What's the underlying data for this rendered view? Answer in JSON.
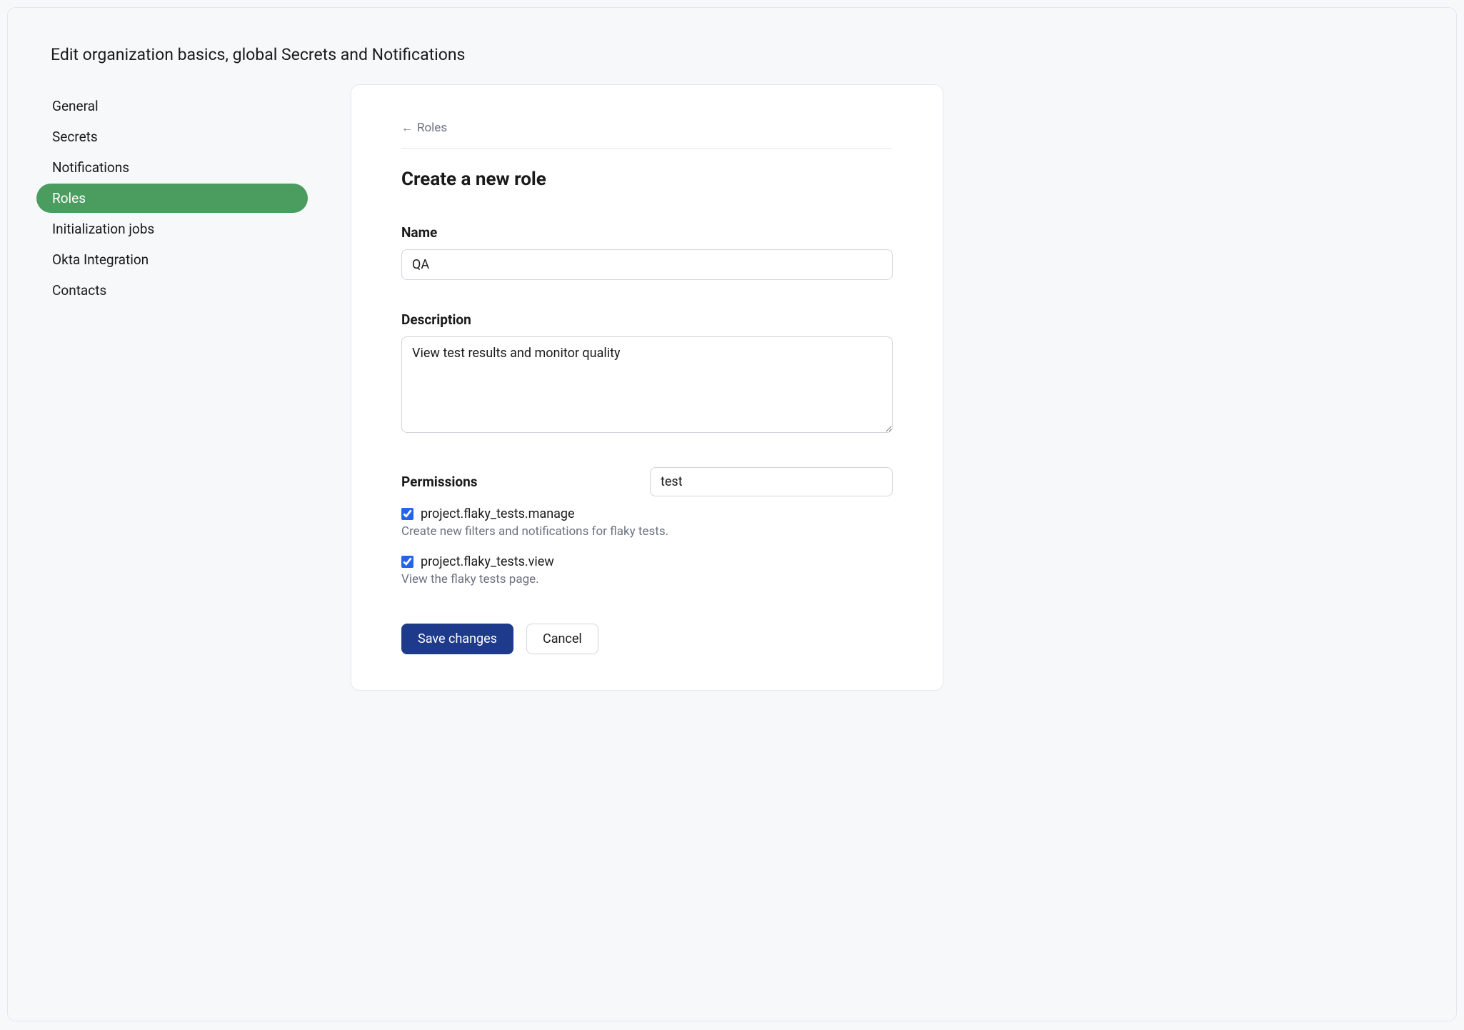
{
  "header": {
    "title": "Edit organization basics, global Secrets and Notifications"
  },
  "sidebar": {
    "items": [
      {
        "label": "General",
        "active": false
      },
      {
        "label": "Secrets",
        "active": false
      },
      {
        "label": "Notifications",
        "active": false
      },
      {
        "label": "Roles",
        "active": true
      },
      {
        "label": "Initialization jobs",
        "active": false
      },
      {
        "label": "Okta Integration",
        "active": false
      },
      {
        "label": "Contacts",
        "active": false
      }
    ]
  },
  "breadcrumb": {
    "back_label": "Roles",
    "arrow": "←"
  },
  "panel": {
    "heading": "Create a new role"
  },
  "form": {
    "name_label": "Name",
    "name_value": "QA",
    "description_label": "Description",
    "description_value": "View test results and monitor quality",
    "permissions_label": "Permissions",
    "filter_value": "test",
    "permissions": [
      {
        "name": "project.flaky_tests.manage",
        "desc": "Create new filters and notifications for flaky tests.",
        "checked": true
      },
      {
        "name": "project.flaky_tests.view",
        "desc": "View the flaky tests page.",
        "checked": true
      }
    ],
    "save_label": "Save changes",
    "cancel_label": "Cancel"
  }
}
